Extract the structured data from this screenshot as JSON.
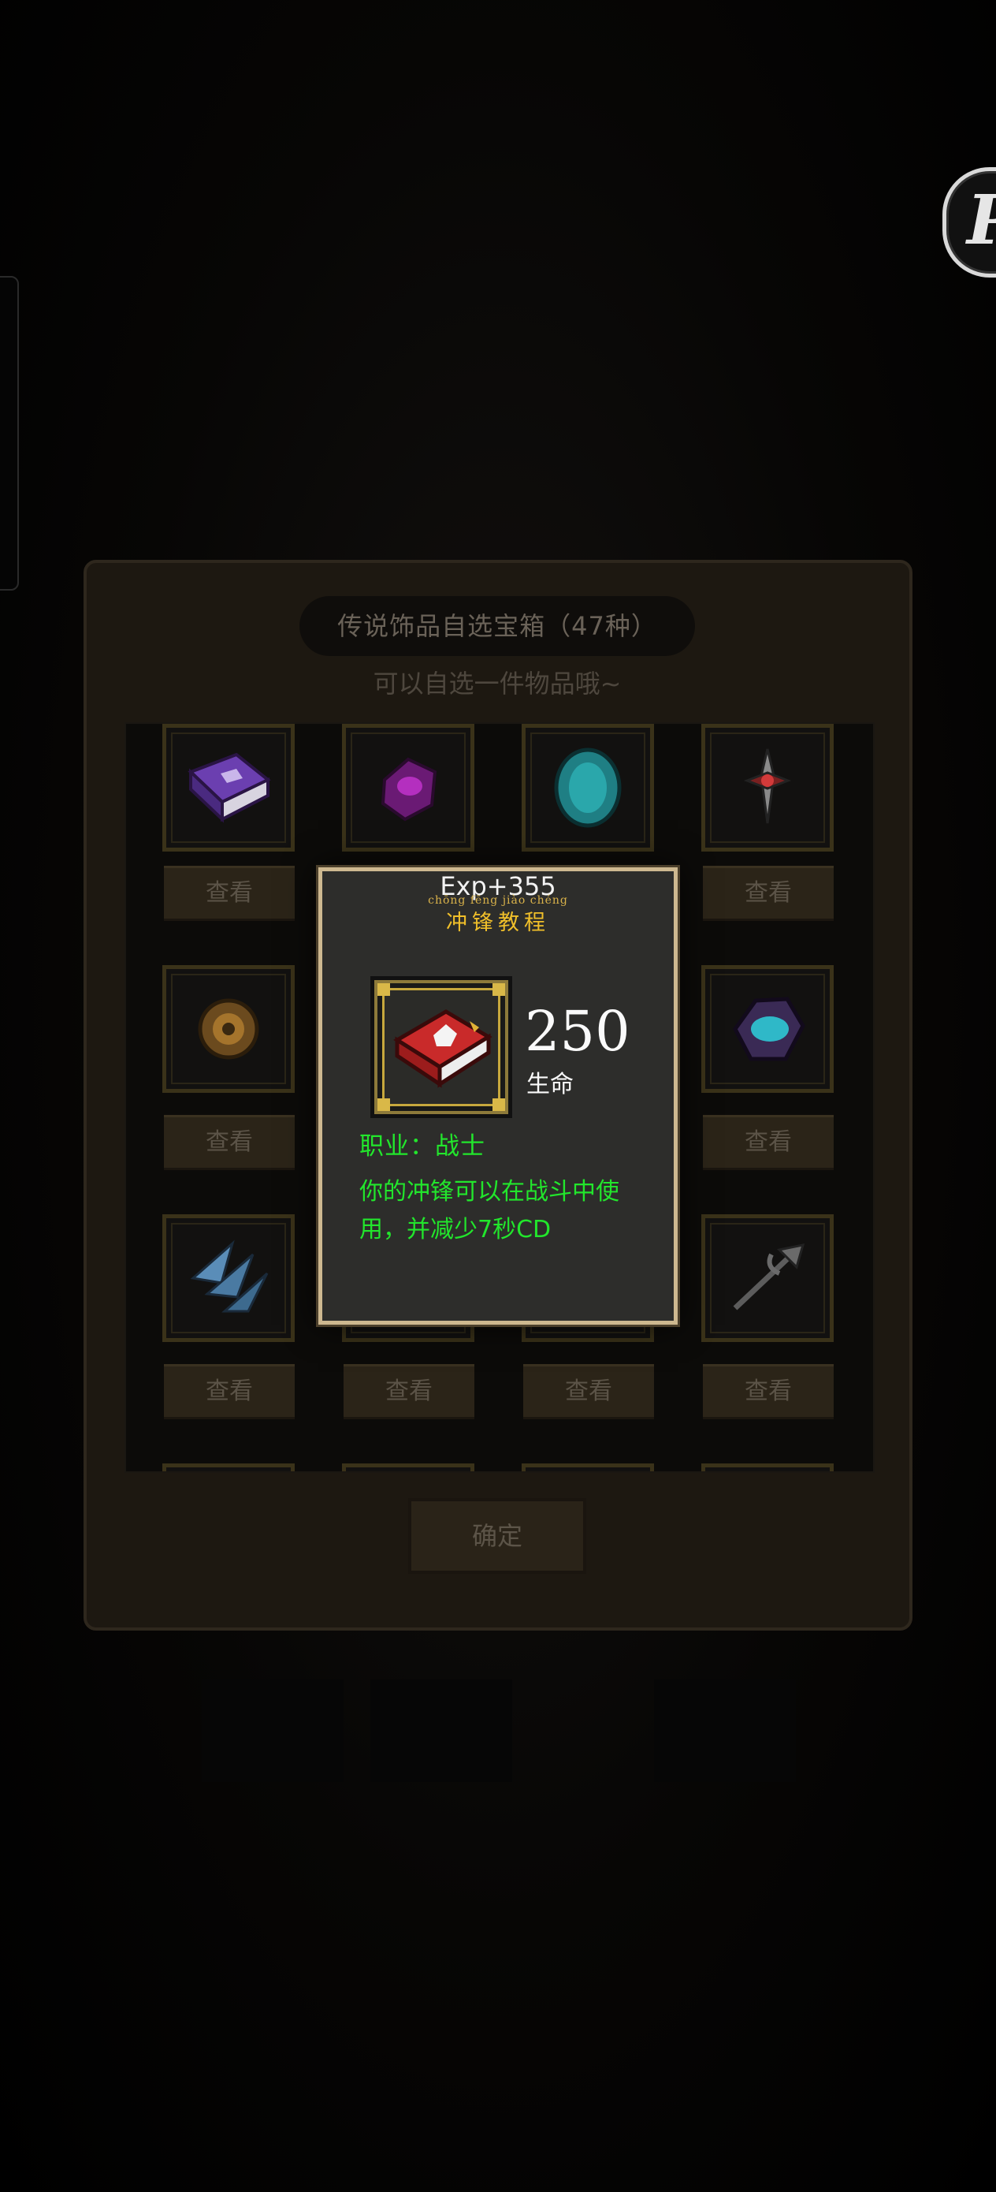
{
  "panel": {
    "title": "传说饰品自选宝箱（47种）",
    "subtitle": "可以自选一件物品哦~",
    "view_label": "查看",
    "confirm_label": "确定"
  },
  "popup": {
    "exp": "Exp+355",
    "pinyin": "chōng fēng jiào chéng",
    "item_name": "冲锋教程",
    "stat_value": "250",
    "stat_label": "生命",
    "job": "职业：战士",
    "description": "你的冲锋可以在战斗中使用，并减少7秒CD"
  },
  "colors": {
    "popup_border": "#cdb890",
    "green_text": "#22e62c",
    "gold_text": "#f0bf2a"
  }
}
